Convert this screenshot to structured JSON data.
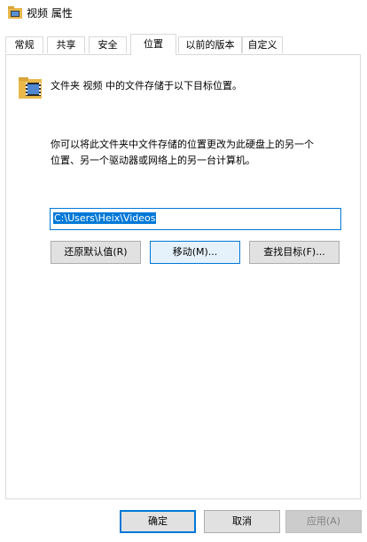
{
  "window": {
    "title": "视频 属性"
  },
  "tabs": [
    {
      "label": "常规",
      "active": false
    },
    {
      "label": "共享",
      "active": false
    },
    {
      "label": "安全",
      "active": false
    },
    {
      "label": "位置",
      "active": true
    },
    {
      "label": "以前的版本",
      "active": false
    },
    {
      "label": "自定义",
      "active": false
    }
  ],
  "location": {
    "folder_icon": "video-folder-icon",
    "info_text": "文件夹 视频 中的文件存储于以下目标位置。",
    "description_line1": "你可以将此文件夹中文件存储的位置更改为此硬盘上的另一个",
    "description_line2": "位置、另一个驱动器或网络上的另一台计算机。",
    "path_value": "C:\\Users\\Heix\\Videos",
    "buttons": {
      "restore_default": "还原默认值(R)",
      "move": "移动(M)...",
      "find_target": "查找目标(F)..."
    }
  },
  "footer": {
    "ok": "确定",
    "cancel": "取消",
    "apply": "应用(A)"
  },
  "colors": {
    "accent": "#0078d7",
    "button_face": "#e1e1e1",
    "border": "#d9d9d9"
  }
}
